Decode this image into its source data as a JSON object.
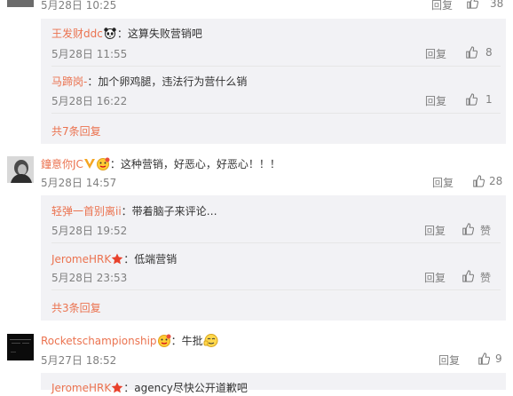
{
  "top_row": {
    "time": "5月28日 10:25",
    "reply": "回复",
    "likes": "38"
  },
  "thread1": {
    "replies": [
      {
        "user": "王发财ddc",
        "text": "：这算失败营销吧",
        "time": "5月28日 11:55",
        "reply": "回复",
        "likes": "8"
      },
      {
        "user": "马蹄岗-",
        "text": "：加个卵鸡腿，违法行为营什么销",
        "time": "5月28日 16:22",
        "reply": "回复",
        "likes": "1"
      }
    ],
    "more": "共7条回复"
  },
  "comment2": {
    "user": "鐘意你JC",
    "text": "：这种营销，好恶心，好恶心！！！",
    "time": "5月28日 14:57",
    "reply": "回复",
    "likes": "28",
    "replies": [
      {
        "user": "轻弹一首别离ii",
        "text": "：带着脑子来评论…",
        "time": "5月28日 19:52",
        "reply": "回复",
        "likes": "赞"
      },
      {
        "user": "JeromeHRK",
        "text": "：低端营销",
        "time": "5月28日 23:53",
        "reply": "回复",
        "likes": "赞"
      }
    ],
    "more": "共3条回复"
  },
  "comment3": {
    "user": "Rocketschampionship",
    "text": "：牛批",
    "time": "5月27日 18:52",
    "reply": "回复",
    "likes": "9",
    "partial_reply": {
      "user": "JeromeHRK",
      "text": "：agency尽快公开道歉吧"
    }
  },
  "colors": {
    "link": "#eb7350",
    "muted": "#808080",
    "subbox": "#f2f2f5"
  },
  "icons": [
    "thumb-up-icon",
    "vip-icon",
    "emoji-icon",
    "star-badge-icon",
    "panda-icon"
  ]
}
